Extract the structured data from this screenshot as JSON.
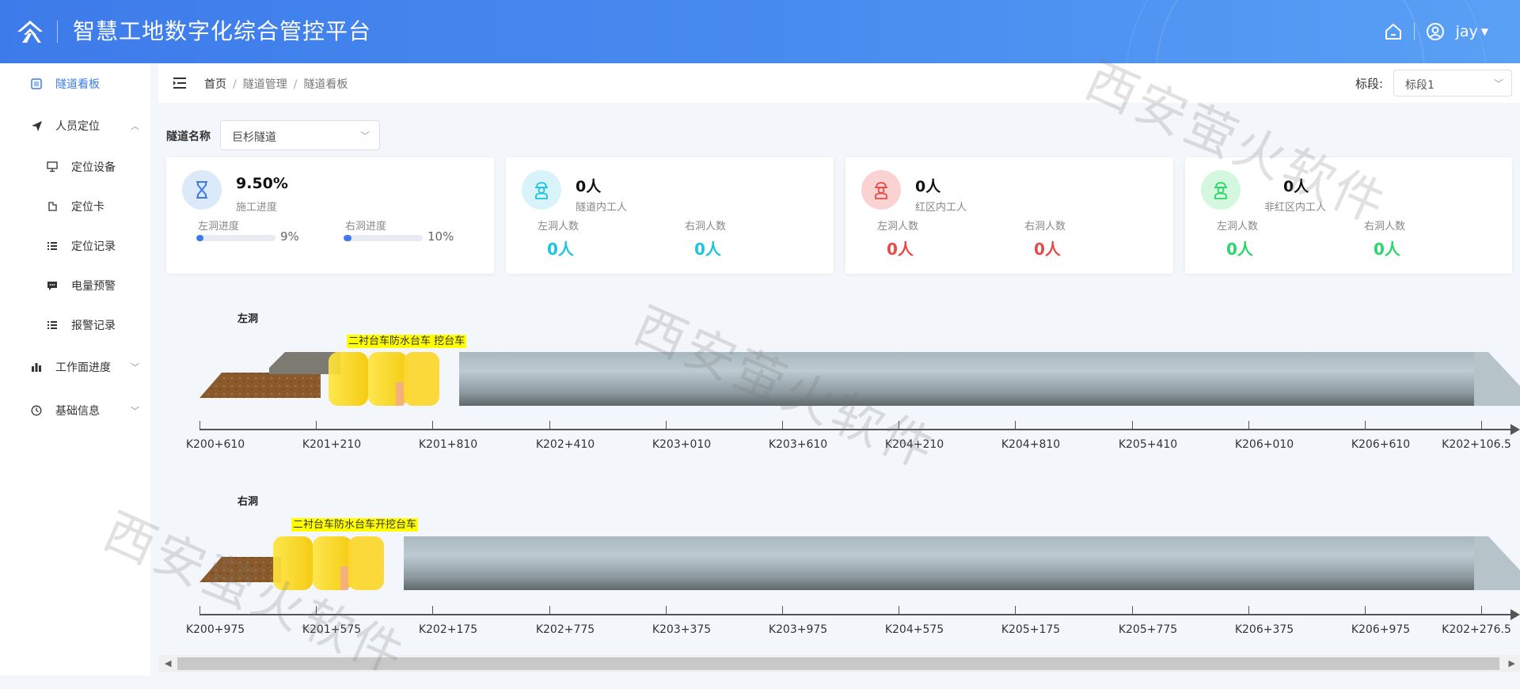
{
  "header": {
    "title": "智慧工地数字化综合管控平台",
    "user": "jay"
  },
  "sidebar": {
    "items": [
      {
        "label": "隧道看板",
        "icon": "dashboard-icon"
      },
      {
        "label": "人员定位",
        "icon": "send-icon"
      },
      {
        "label": "定位设备",
        "icon": "monitor-icon"
      },
      {
        "label": "定位卡",
        "icon": "card-icon"
      },
      {
        "label": "定位记录",
        "icon": "list-icon"
      },
      {
        "label": "电量预警",
        "icon": "message-icon"
      },
      {
        "label": "报警记录",
        "icon": "list-icon"
      },
      {
        "label": "工作面进度",
        "icon": "bar-chart-icon"
      },
      {
        "label": "基础信息",
        "icon": "clock-icon"
      }
    ]
  },
  "breadcrumb": [
    "首页",
    "隧道管理",
    "隧道看板"
  ],
  "segment": {
    "label": "标段:",
    "value": "标段1"
  },
  "tunnel_select": {
    "label": "隧道名称",
    "value": "巨杉隧道"
  },
  "cards": [
    {
      "value": "9.50%",
      "label": "施工进度",
      "left_label": "左洞进度",
      "left_pct": "9%",
      "left_fill": 9,
      "right_label": "右洞进度",
      "right_pct": "10%",
      "right_fill": 10
    },
    {
      "value": "0人",
      "label": "隧道内工人",
      "left_label": "左洞人数",
      "left_value": "0人",
      "right_label": "右洞人数",
      "right_value": "0人"
    },
    {
      "value": "0人",
      "label": "红区内工人",
      "left_label": "左洞人数",
      "left_value": "0人",
      "right_label": "右洞人数",
      "right_value": "0人"
    },
    {
      "value": "0人",
      "label": "非红区内工人",
      "left_label": "左洞人数",
      "left_value": "0人",
      "right_label": "右洞人数",
      "right_value": "0人"
    }
  ],
  "colors": {
    "accent": "#3d7bea",
    "cyan": "#1ec4e0",
    "red": "#e84a4a",
    "green": "#2bd66a"
  },
  "left_tunnel": {
    "label": "左洞",
    "equipment": "二衬台车防水台车 挖台车",
    "ticks": [
      "K200+610",
      "K201+210",
      "K201+810",
      "K202+410",
      "K203+010",
      "K203+610",
      "K204+210",
      "K204+810",
      "K205+410",
      "K206+010",
      "K206+610",
      "K202+106.5"
    ]
  },
  "right_tunnel": {
    "label": "右洞",
    "equipment": "二衬台车防水台车开挖台车",
    "ticks": [
      "K200+975",
      "K201+575",
      "K202+175",
      "K202+775",
      "K203+375",
      "K203+975",
      "K204+575",
      "K205+175",
      "K205+775",
      "K206+375",
      "K206+975",
      "K202+276.5"
    ]
  },
  "watermark": "西安萤火软件"
}
